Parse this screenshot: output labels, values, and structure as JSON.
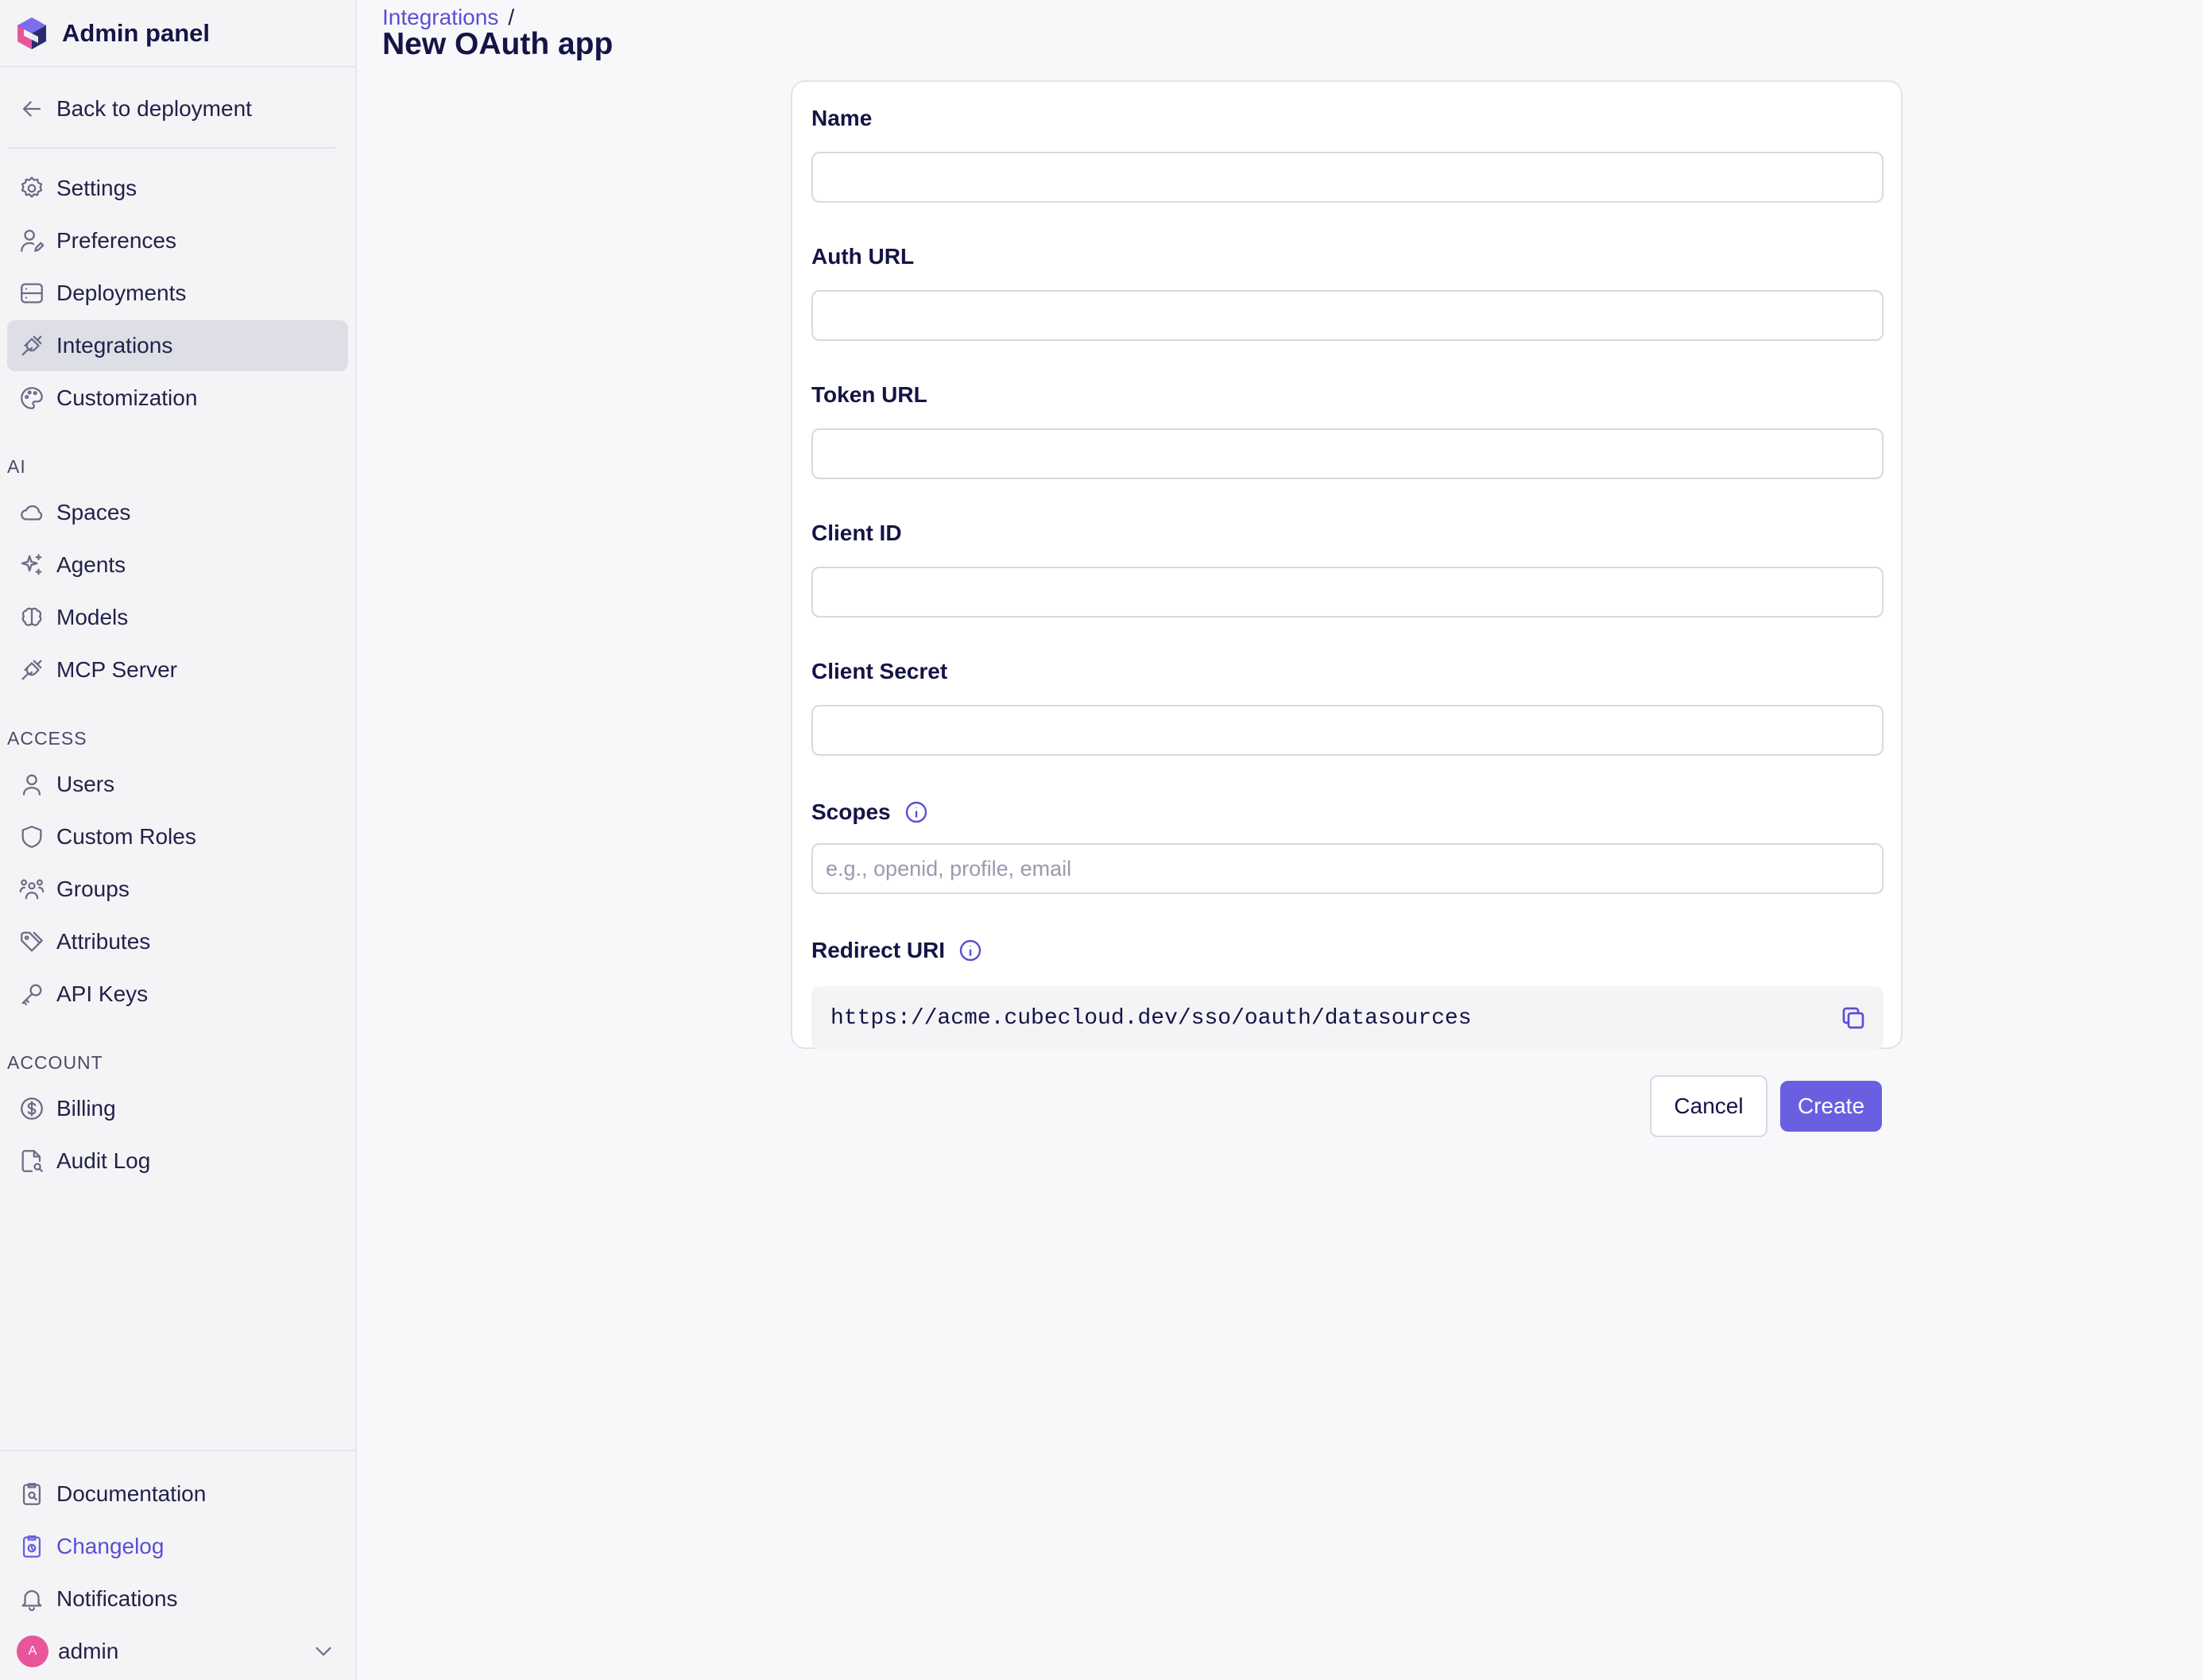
{
  "sidebar": {
    "title": "Admin panel",
    "back_label": "Back to deployment",
    "items_main": [
      {
        "label": "Settings",
        "icon": "gear-icon"
      },
      {
        "label": "Preferences",
        "icon": "user-edit-icon"
      },
      {
        "label": "Deployments",
        "icon": "server-icon"
      },
      {
        "label": "Integrations",
        "icon": "plug-icon",
        "active": true
      },
      {
        "label": "Customization",
        "icon": "palette-icon"
      }
    ],
    "section_ai": "AI",
    "items_ai": [
      {
        "label": "Spaces",
        "icon": "cloud-icon"
      },
      {
        "label": "Agents",
        "icon": "sparkles-icon"
      },
      {
        "label": "Models",
        "icon": "brain-icon"
      },
      {
        "label": "MCP Server",
        "icon": "plug-icon"
      }
    ],
    "section_access": "ACCESS",
    "items_access": [
      {
        "label": "Users",
        "icon": "user-icon"
      },
      {
        "label": "Custom Roles",
        "icon": "shield-icon"
      },
      {
        "label": "Groups",
        "icon": "users-icon"
      },
      {
        "label": "Attributes",
        "icon": "tag-icon"
      },
      {
        "label": "API Keys",
        "icon": "key-icon"
      }
    ],
    "section_account": "ACCOUNT",
    "items_account": [
      {
        "label": "Billing",
        "icon": "dollar-icon"
      },
      {
        "label": "Audit Log",
        "icon": "file-search-icon"
      }
    ],
    "bottom": {
      "documentation": "Documentation",
      "changelog": "Changelog",
      "notifications": "Notifications",
      "user_initial": "A",
      "user_name": "admin"
    }
  },
  "header": {
    "breadcrumb_link": "Integrations",
    "breadcrumb_sep": "/",
    "title": "New OAuth app"
  },
  "form": {
    "name_label": "Name",
    "name_value": "",
    "auth_url_label": "Auth URL",
    "auth_url_value": "",
    "token_url_label": "Token URL",
    "token_url_value": "",
    "client_id_label": "Client ID",
    "client_id_value": "",
    "client_secret_label": "Client Secret",
    "client_secret_value": "",
    "scopes_label": "Scopes",
    "scopes_placeholder": "e.g., openid, profile, email",
    "redirect_label": "Redirect URI",
    "redirect_value": "https://acme.cubecloud.dev/sso/oauth/datasources",
    "cancel_label": "Cancel",
    "create_label": "Create"
  },
  "colors": {
    "accent": "#6a5fe0",
    "link": "#5a4fd6",
    "sidebar_bg": "#f4f4f7",
    "active_bg": "#dedee6",
    "avatar": "#e8559a"
  }
}
